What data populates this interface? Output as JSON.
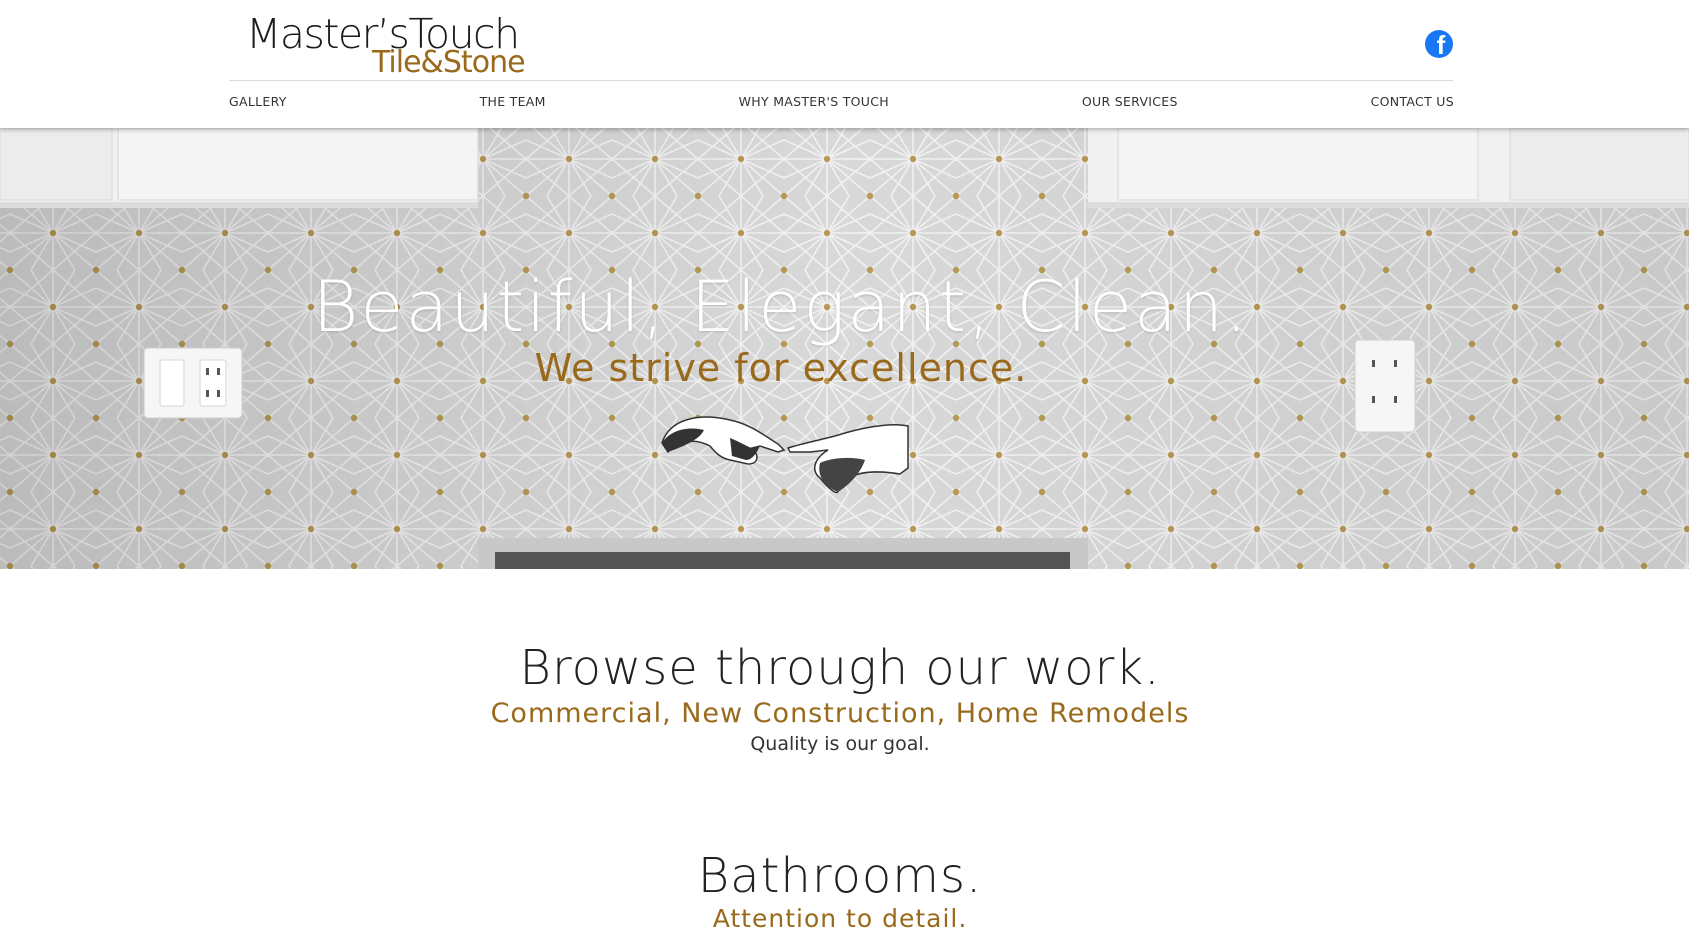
{
  "brand": {
    "logo_main": "Master’sTouch",
    "logo_sub": "Tile&Stone",
    "accent_color": "#9a6a1c"
  },
  "header": {
    "social_icon": "facebook-icon",
    "nav": [
      {
        "label": "GALLERY"
      },
      {
        "label": "THE TEAM"
      },
      {
        "label": "WHY MASTER'S TOUCH"
      },
      {
        "label": "OUR SERVICES"
      },
      {
        "label": "CONTACT US"
      }
    ]
  },
  "hero": {
    "title": "Beautiful, Elegant, Clean.",
    "subtitle": "We strive for excellence."
  },
  "browse": {
    "heading": "Browse through our work.",
    "categories": "Commercial, New Construction, Home Remodels",
    "tagline": "Quality is our goal."
  },
  "bathrooms": {
    "heading": "Bathrooms.",
    "tagline": "Attention to detail."
  }
}
